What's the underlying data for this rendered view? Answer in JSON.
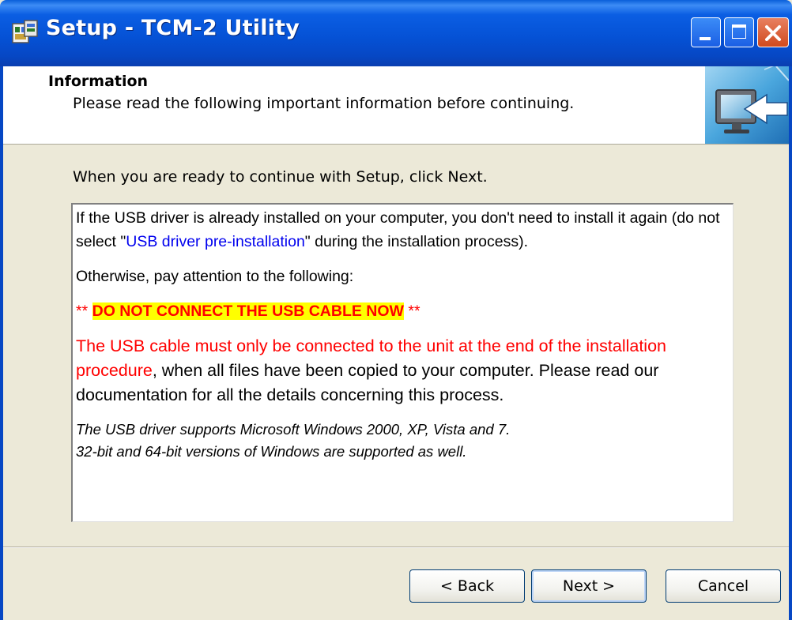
{
  "window": {
    "title": "Setup - TCM-2 Utility",
    "icons": {
      "app": "setup-app-icon",
      "minimize": "minimize-icon",
      "maximize": "maximize-icon",
      "close": "close-icon"
    },
    "colors": {
      "titlebar": "#0552d6",
      "close": "#d04a1e",
      "face": "#ece9d8"
    }
  },
  "header": {
    "title": "Information",
    "subtitle": "Please read the following important information before continuing.",
    "image_icon": "monitor-arrow-icon"
  },
  "instruction": "When you are ready to continue with Setup, click Next.",
  "memo": {
    "p1_a": "If the USB driver is already installed on your computer, you don't need to install it again (do not select \"",
    "p1_link": "USB driver pre-installation",
    "p1_b": "\" during the installation process).",
    "p2": "Otherwise, pay attention to the following:",
    "p3_stars_l": "** ",
    "p3_warn": "DO NOT CONNECT THE USB CABLE NOW",
    "p3_stars_r": " **",
    "p4_red": "The USB cable must only be connected to the unit at the end of the installation procedure",
    "p4_rest": ", when all files have been copied to your computer. Please read our documentation for all the details concerning this process.",
    "p5_line1": "The USB driver supports Microsoft Windows 2000, XP, Vista and 7.",
    "p5_line2": "32-bit and 64-bit versions of Windows are supported as well.",
    "colors": {
      "link": "#0000ee",
      "warning_text": "#ff0000",
      "warning_highlight": "#ffff00"
    }
  },
  "buttons": {
    "back": "< Back",
    "next": "Next >",
    "cancel": "Cancel"
  }
}
